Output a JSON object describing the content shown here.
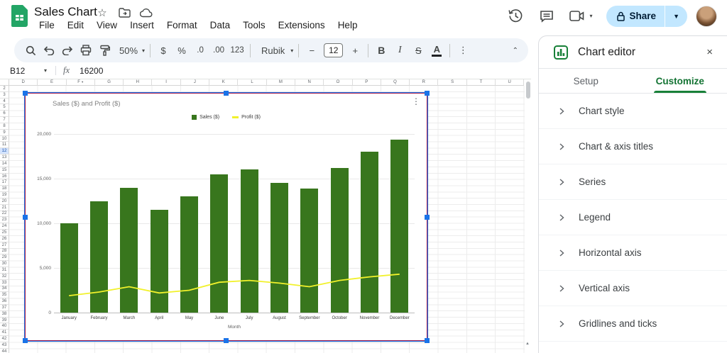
{
  "header": {
    "title": "Sales Chart",
    "menu": [
      "File",
      "Edit",
      "View",
      "Insert",
      "Format",
      "Data",
      "Tools",
      "Extensions",
      "Help"
    ],
    "share_label": "Share"
  },
  "toolbar": {
    "zoom": "50%",
    "currency": "$",
    "percent": "%",
    "decrease_decimal": ".0",
    "increase_decimal": ".00",
    "more_formats": "123",
    "font": "Rubik",
    "font_size": "12",
    "bold": "B",
    "italic": "I",
    "strikethrough": "S",
    "text_color": "A"
  },
  "formula_bar": {
    "cell": "B12",
    "fx": "fx",
    "value": "16200"
  },
  "grid": {
    "columns": [
      "D",
      "E",
      "F",
      "G",
      "H",
      "I",
      "J",
      "K",
      "L",
      "M",
      "N",
      "O",
      "P",
      "Q",
      "R",
      "S",
      "T",
      "U"
    ],
    "filtered_column": "F",
    "rows": [
      "2",
      "3",
      "4",
      "5",
      "6",
      "7",
      "8",
      "9",
      "10",
      "11",
      "12",
      "13",
      "14",
      "15",
      "16",
      "17",
      "18",
      "19",
      "20",
      "21",
      "22",
      "23",
      "24",
      "25",
      "26",
      "27",
      "28",
      "29",
      "30",
      "31",
      "32",
      "33",
      "34",
      "35",
      "36",
      "37",
      "38",
      "39",
      "40",
      "41",
      "42",
      "43",
      "44"
    ],
    "selected_row": "12"
  },
  "chart_data": {
    "type": "bar",
    "title": "Sales ($) and Profit ($)",
    "xlabel": "Month",
    "ylabel": "",
    "ylim": [
      0,
      20000
    ],
    "yticks": [
      "0",
      "5,000",
      "10,000",
      "15,000",
      "20,000"
    ],
    "ytick_values": [
      0,
      5000,
      10000,
      15000,
      20000
    ],
    "grid": true,
    "legend_position": "top",
    "categories": [
      "January",
      "February",
      "March",
      "April",
      "May",
      "June",
      "July",
      "August",
      "September",
      "October",
      "November",
      "December"
    ],
    "series": [
      {
        "name": "Sales ($)",
        "type": "bar",
        "color": "#38761d",
        "values": [
          10000,
          12500,
          14000,
          11500,
          13000,
          15500,
          16000,
          14500,
          13900,
          16200,
          18000,
          19400
        ]
      },
      {
        "name": "Profit ($)",
        "type": "line",
        "color": "#f1f12b",
        "values": [
          1900,
          2300,
          2900,
          2200,
          2500,
          3400,
          3600,
          3300,
          2900,
          3600,
          4000,
          4300
        ]
      }
    ]
  },
  "panel": {
    "title": "Chart editor",
    "tabs": [
      {
        "label": "Setup",
        "active": false
      },
      {
        "label": "Customize",
        "active": true
      }
    ],
    "sections": [
      "Chart style",
      "Chart & axis titles",
      "Series",
      "Legend",
      "Horizontal axis",
      "Vertical axis",
      "Gridlines and ticks"
    ]
  },
  "colors": {
    "accent_blue": "#1a73e8",
    "selection_border": "#a61d4c",
    "share_bg": "#c2e7ff",
    "tab_green": "#137333",
    "bar_green": "#38761d",
    "line_yellow": "#f1f12b",
    "row_highlight": "#d3e3fd"
  }
}
